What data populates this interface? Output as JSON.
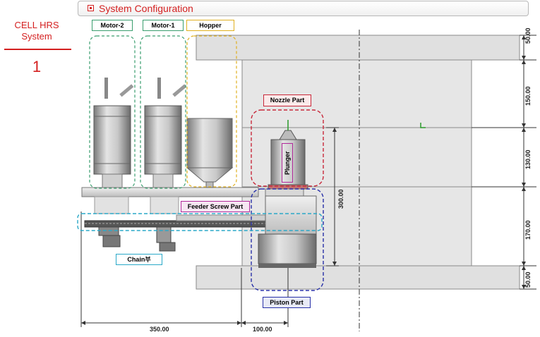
{
  "sidebar": {
    "title_line1": "CELL HRS",
    "title_line2": "System",
    "number": "1"
  },
  "header": {
    "title": "System Configuration"
  },
  "tags": {
    "motor2": "Motor-2",
    "motor1": "Motor-1",
    "hopper": "Hopper",
    "nozzle": "Nozzle Part",
    "feeder": "Feeder Screw Part",
    "chain": "Chain부",
    "piston": "Piston Part",
    "plunger": "Plunger"
  },
  "dimensions": {
    "right_50_top": "50.00",
    "right_150": "150.00",
    "right_130": "130.00",
    "right_170": "170.00",
    "right_50_bottom": "50.00",
    "height_300": "300.00",
    "width_350": "350.00",
    "width_100": "100.00"
  },
  "colors": {
    "accent": "#d42020",
    "motor_outline": "#3a9e6e",
    "hopper_outline": "#e0b020",
    "nozzle_outline": "#c8283a",
    "feeder_outline": "#b0289a",
    "chain_outline": "#2aa8c8",
    "piston_outline": "#2830a8"
  }
}
